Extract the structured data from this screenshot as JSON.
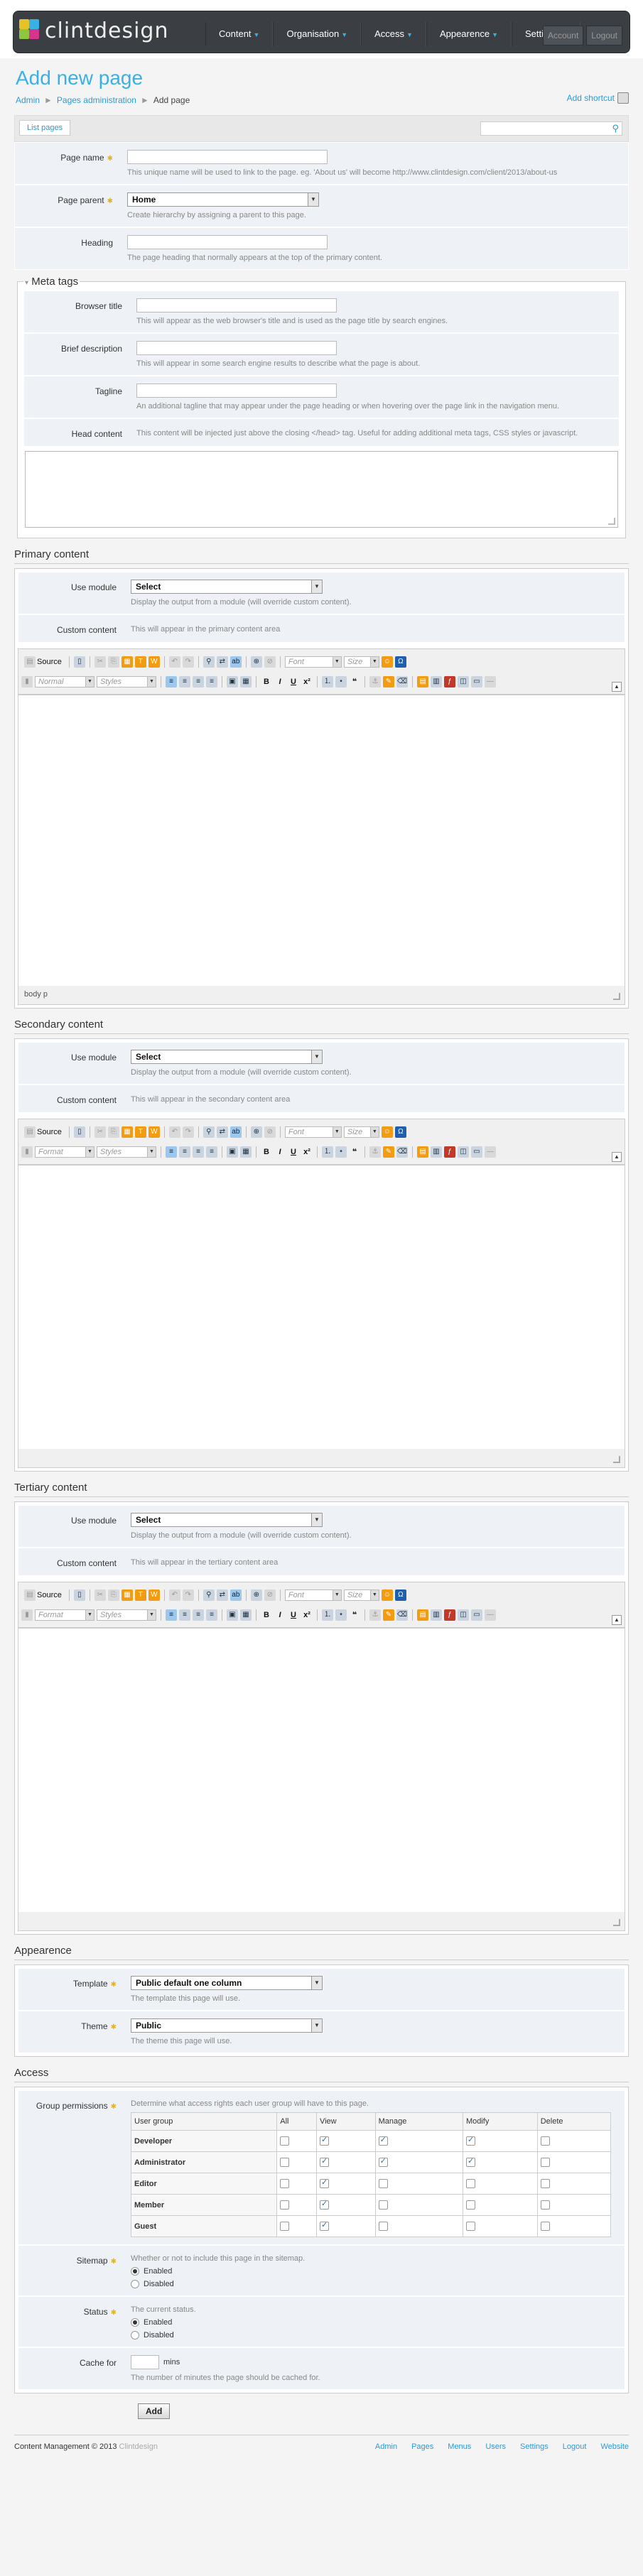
{
  "header": {
    "logo_text": "clintdesign",
    "nav": [
      {
        "label": "Content"
      },
      {
        "label": "Organisation"
      },
      {
        "label": "Access"
      },
      {
        "label": "Appearence"
      },
      {
        "label": "Settings"
      }
    ],
    "account_label": "Account",
    "logout_label": "Logout"
  },
  "page": {
    "title": "Add new page",
    "crumbs": [
      "Admin",
      "Pages administration",
      "Add page"
    ],
    "shortcut_label": "Add shortcut"
  },
  "toolbar": {
    "list_label": "List pages",
    "search_placeholder": ""
  },
  "form": {
    "page_name": {
      "label": "Page name",
      "value": "",
      "help": "This unique name will be used to link to the page. eg. 'About us' will become http://www.clintdesign.com/client/2013/about-us"
    },
    "page_parent": {
      "label": "Page parent",
      "value": "Home",
      "help": "Create hierarchy by assigning a parent to this page."
    },
    "heading": {
      "label": "Heading",
      "value": "",
      "help": "The page heading that normally appears at the top of the primary content."
    }
  },
  "meta": {
    "legend": "Meta tags",
    "browser_title": {
      "label": "Browser title",
      "help": "This will appear as the web browser's title and is used as the page title by search engines."
    },
    "brief": {
      "label": "Brief description",
      "help": "This will appear in some search engine results to describe what the page is about."
    },
    "tagline": {
      "label": "Tagline",
      "help": "An additional tagline that may appear under the page heading or when hovering over the page link in the navigation menu."
    },
    "head_content": {
      "label": "Head content",
      "help": "This content will be injected just above the closing </head> tag. Useful for adding additional meta tags, CSS styles or javascript."
    }
  },
  "primary": {
    "title": "Primary content",
    "module_label": "Use module",
    "module_value": "Select",
    "module_help": "Display the output from a module (will override custom content).",
    "custom_label": "Custom content",
    "custom_help": "This will appear in the primary content area",
    "format": "Normal",
    "status_path": "body  p"
  },
  "secondary": {
    "title": "Secondary content",
    "module_label": "Use module",
    "module_value": "Select",
    "module_help": "Display the output from a module (will override custom content).",
    "custom_label": "Custom content",
    "custom_help": "This will appear in the secondary content area",
    "format": "Format"
  },
  "tertiary": {
    "title": "Tertiary content",
    "module_label": "Use module",
    "module_value": "Select",
    "module_help": "Display the output from a module (will override custom content).",
    "custom_label": "Custom content",
    "custom_help": "This will appear in the tertiary content area",
    "format": "Format"
  },
  "editor": {
    "source": "Source",
    "styles": "Styles",
    "font": "Font",
    "size": "Size"
  },
  "appearance": {
    "title": "Appearence",
    "template_label": "Template",
    "template_value": "Public default one column",
    "template_help": "The template this page will use.",
    "theme_label": "Theme",
    "theme_value": "Public",
    "theme_help": "The theme this page will use."
  },
  "access": {
    "title": "Access",
    "perm_label": "Group permissions",
    "perm_help": "Determine what access rights each user group will have to this page.",
    "columns": [
      "User group",
      "All",
      "View",
      "Manage",
      "Modify",
      "Delete"
    ],
    "rows": [
      {
        "group": "Developer",
        "checks": [
          false,
          true,
          true,
          true,
          false
        ]
      },
      {
        "group": "Administrator",
        "checks": [
          false,
          true,
          true,
          true,
          false
        ]
      },
      {
        "group": "Editor",
        "checks": [
          false,
          true,
          false,
          false,
          false
        ]
      },
      {
        "group": "Member",
        "checks": [
          false,
          true,
          false,
          false,
          false
        ]
      },
      {
        "group": "Guest",
        "checks": [
          false,
          true,
          false,
          false,
          false
        ]
      }
    ],
    "sitemap_label": "Sitemap",
    "sitemap_help": "Whether or not to include this page in the sitemap.",
    "sitemap_opts": [
      "Enabled",
      "Disabled"
    ],
    "status_label": "Status",
    "status_help": "The current status.",
    "status_opts": [
      "Enabled",
      "Disabled"
    ],
    "cache_label": "Cache for",
    "cache_unit": "mins",
    "cache_help": "The number of minutes the page should be cached for.",
    "add_label": "Add"
  },
  "footer": {
    "text": "Content Management © 2013",
    "brand": "Clintdesign",
    "links": [
      "Admin",
      "Pages",
      "Menus",
      "Users",
      "Settings",
      "Logout",
      "Website"
    ]
  },
  "colors": {
    "accent": "#3ab1e6",
    "header_bg": "#3b3f44",
    "row_bg": "#eef2f6"
  }
}
